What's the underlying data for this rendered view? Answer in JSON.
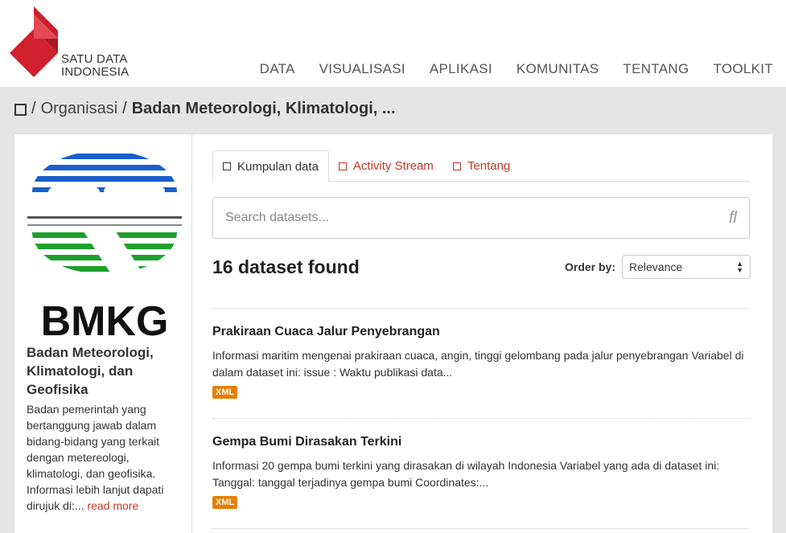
{
  "header": {
    "logo_line1": "SATU DATA",
    "logo_line2": "INDONESIA",
    "nav": [
      "DATA",
      "VISUALISASI",
      "APLIKASI",
      "KOMUNITAS",
      "TENTANG",
      "TOOLKIT"
    ]
  },
  "breadcrumb": {
    "item1": "Organisasi",
    "current": "Badan Meteorologi, Klimatologi, ..."
  },
  "org": {
    "logo_text": "BMKG",
    "title": "Badan Meteorologi, Klimatologi, dan Geofisika",
    "description": "Badan pemerintah yang bertanggung jawab dalam bidang-bidang yang terkait dengan metereologi, klimatologi, dan geofisika. Informasi lebih lanjut dapati dirujuk di:...",
    "read_more": "read more"
  },
  "tabs": [
    "Kumpulan data",
    "Activity Stream",
    "Tentang"
  ],
  "search": {
    "placeholder": "Search datasets..."
  },
  "results": {
    "count_text": "16 dataset found",
    "order_label": "Order by:",
    "order_value": "Relevance"
  },
  "datasets": [
    {
      "title": "Prakiraan Cuaca Jalur Penyebrangan",
      "description": "Informasi maritim mengenai prakiraan cuaca, angin, tinggi gelombang pada jalur penyebrangan Variabel di dalam dataset ini: issue : Waktu publikasi data...",
      "format": "XML"
    },
    {
      "title": "Gempa Bumi Dirasakan Terkini",
      "description": "Informasi 20 gempa bumi terkini yang dirasakan di wilayah Indonesia Variabel yang ada di dataset ini: Tanggal: tanggal terjadinya gempa bumi Coordinates:...",
      "format": "XML"
    }
  ],
  "colors": {
    "brand_red": "#d0202e",
    "link_red": "#c0392b",
    "badge_orange": "#e67e00",
    "bmkg_blue": "#1a5fcc",
    "bmkg_green": "#1fa02c"
  }
}
